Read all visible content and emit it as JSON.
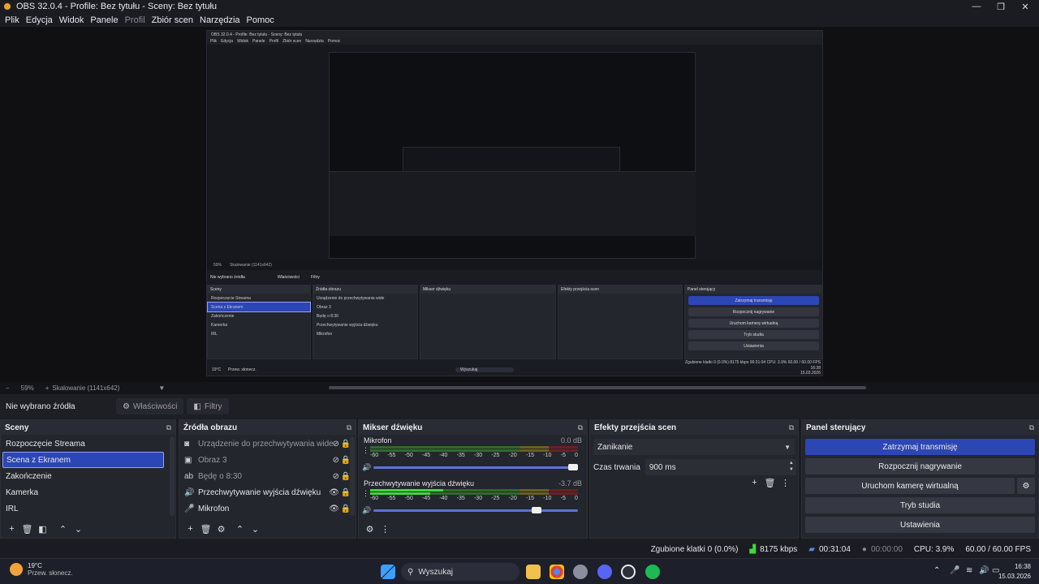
{
  "window": {
    "title": "OBS 32.0.4 - Profile: Bez tytułu - Sceny: Bez tytułu",
    "controls": {
      "minimize": "—",
      "maximize": "❐",
      "close": "✕"
    }
  },
  "menu": [
    "Plik",
    "Edycja",
    "Widok",
    "Panele",
    "Profil",
    "Zbiór scen",
    "Narzędzia",
    "Pomoc"
  ],
  "preview_nested": {
    "title": "OBS 32.0.4 - Profile: Bez tytułu - Sceny: Bez tytułu",
    "zoom": "59%",
    "scaling": "Skalowanie (1141x642)",
    "no_source": "Nie wybrano źródła",
    "properties": "Właściwości",
    "filters": "Filtry",
    "scenes_title": "Sceny",
    "sources_title": "Źródła obrazu",
    "mixer_title": "Mikser dźwięku",
    "transitions_title": "Efekty przejścia scen",
    "controls_title": "Panel sterujący",
    "scenes": [
      "Rozpoczęcie Streama",
      "Scena z Ekranem",
      "Zakończenie",
      "Kamerka",
      "IRL"
    ],
    "sources": [
      "Urządzenie do przechwytywania wide",
      "Obraz 3",
      "Będę o 8:30",
      "Przechwytywanie wyjścia dźwięku",
      "Mikrofon"
    ],
    "controls": [
      "Zatrzymaj transmisję",
      "Rozpocznij nagrywanie",
      "Uruchom kamerę wirtualną",
      "Tryb studia",
      "Ustawienia"
    ],
    "status": "Zgubione klatki 0 (0.0%)   8175 kbps   00:31:04   CPU: 3.9%   60.00 / 60.00 FPS",
    "clock_time": "16:38",
    "clock_date": "15.03.2026",
    "weather_temp": "19°C",
    "weather_desc": "Przew. słonecz.",
    "search": "Wyszukaj"
  },
  "zoombar": {
    "minus": "−",
    "zoom": "59%",
    "plus": "+",
    "scaling": "Skalowanie (1141x642)",
    "caret": "▼"
  },
  "sourcebar": {
    "no_source": "Nie wybrano źródła",
    "properties": "Właściwości",
    "filters": "Filtry"
  },
  "scenes": {
    "title": "Sceny",
    "items": [
      "Rozpoczęcie Streama",
      "Scena z Ekranem",
      "Zakończenie",
      "Kamerka",
      "IRL"
    ],
    "selected_index": 1
  },
  "sources": {
    "title": "Źródła obrazu",
    "items": [
      {
        "label": "Urządzenie do przechwytywania wide",
        "icon": "camera-icon",
        "glyph": "◙",
        "eye": "⊘",
        "lock": "🔒",
        "disabled": true
      },
      {
        "label": "Obraz 3",
        "icon": "image-icon",
        "glyph": "▣",
        "eye": "⊘",
        "lock": "🔒",
        "disabled": true
      },
      {
        "label": "Będę o 8:30",
        "icon": "text-icon",
        "glyph": "ab",
        "eye": "⊘",
        "lock": "🔒",
        "disabled": true
      },
      {
        "label": "Przechwytywanie wyjścia dźwięku",
        "icon": "speaker-icon",
        "glyph": "🔊",
        "eye": "👁",
        "lock": "🔒",
        "disabled": false
      },
      {
        "label": "Mikrofon",
        "icon": "microphone-icon",
        "glyph": "🎤",
        "eye": "👁",
        "lock": "🔒",
        "disabled": false
      }
    ]
  },
  "mixer": {
    "title": "Mikser dźwięku",
    "ticks": [
      "-60",
      "-55",
      "-50",
      "-45",
      "-40",
      "-35",
      "-30",
      "-25",
      "-20",
      "-15",
      "-10",
      "-5",
      "0"
    ],
    "channels": [
      {
        "name": "Mikrofon",
        "db": "0.0 dB",
        "level_top": 0.0,
        "level_bottom": 0.0,
        "volume": 1.0
      },
      {
        "name": "Przechwytywanie wyjścia dźwięku",
        "db": "-3.7 dB",
        "level_top": 0.35,
        "level_bottom": 0.29,
        "volume": 0.82
      }
    ]
  },
  "transitions": {
    "title": "Efekty przejścia scen",
    "selected": "Zanikanie",
    "duration_label": "Czas trwania",
    "duration_value": "900 ms"
  },
  "controls": {
    "title": "Panel sterujący",
    "stop_stream": "Zatrzymaj transmisję",
    "start_recording": "Rozpocznij nagrywanie",
    "virtual_cam": "Uruchom kamerę wirtualną",
    "studio_mode": "Tryb studia",
    "settings": "Ustawienia"
  },
  "statusbar": {
    "dropped": "Zgubione klatki 0 (0.0%)",
    "bitrate": "8175 kbps",
    "stream_time": "00:31:04",
    "record_time": "00:00:00",
    "cpu": "CPU: 3.9%",
    "fps": "60.00 / 60.00 FPS"
  },
  "taskbar": {
    "weather_temp": "19°C",
    "weather_desc": "Przew. słonecz.",
    "search": "Wyszukaj",
    "clock_time": "16:38",
    "clock_date": "15.03.2026"
  },
  "colors": {
    "accent": "#2c46b5",
    "background": "#1b1c22",
    "panel": "#24262e",
    "meter_green": "#3fd93a"
  }
}
